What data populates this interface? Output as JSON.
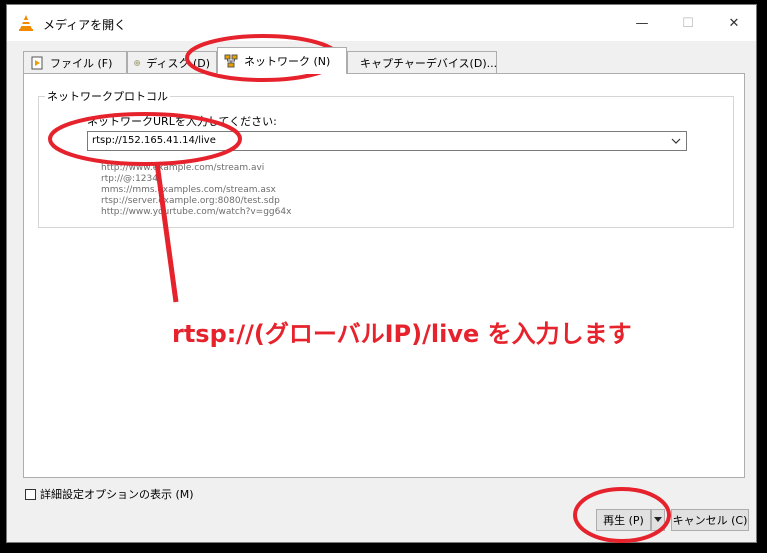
{
  "window": {
    "title": "メディアを開く",
    "minimize": "—",
    "maximize": "☐",
    "close": "✕"
  },
  "tabs": [
    {
      "label": "ファイル (F)",
      "icon": "file-icon",
      "active": false
    },
    {
      "label": "ディスク (D)",
      "icon": "disc-icon",
      "active": false
    },
    {
      "label": "ネットワーク (N)",
      "icon": "network-icon",
      "active": true
    },
    {
      "label": "キャプチャーデバイス(D)...",
      "icon": "capture-device-icon",
      "active": false
    }
  ],
  "network": {
    "group_title": "ネットワークプロトコル",
    "url_label": "ネットワークURLを入力してください:",
    "url_value": "rtsp://152.165.41.14/live",
    "examples": [
      "http://www.example.com/stream.avi",
      "rtp://@:1234",
      "mms://mms.examples.com/stream.asx",
      "rtsp://server.example.org:8080/test.sdp",
      "http://www.yourtube.com/watch?v=gg64x"
    ]
  },
  "options": {
    "advanced_label": "詳細設定オプションの表示 (M)"
  },
  "buttons": {
    "play": "再生 (P)",
    "cancel": "キャンセル (C)"
  },
  "annotation": {
    "text": "rtsp://(グローバルIP)/live を入力します",
    "color": "#e6232d"
  }
}
